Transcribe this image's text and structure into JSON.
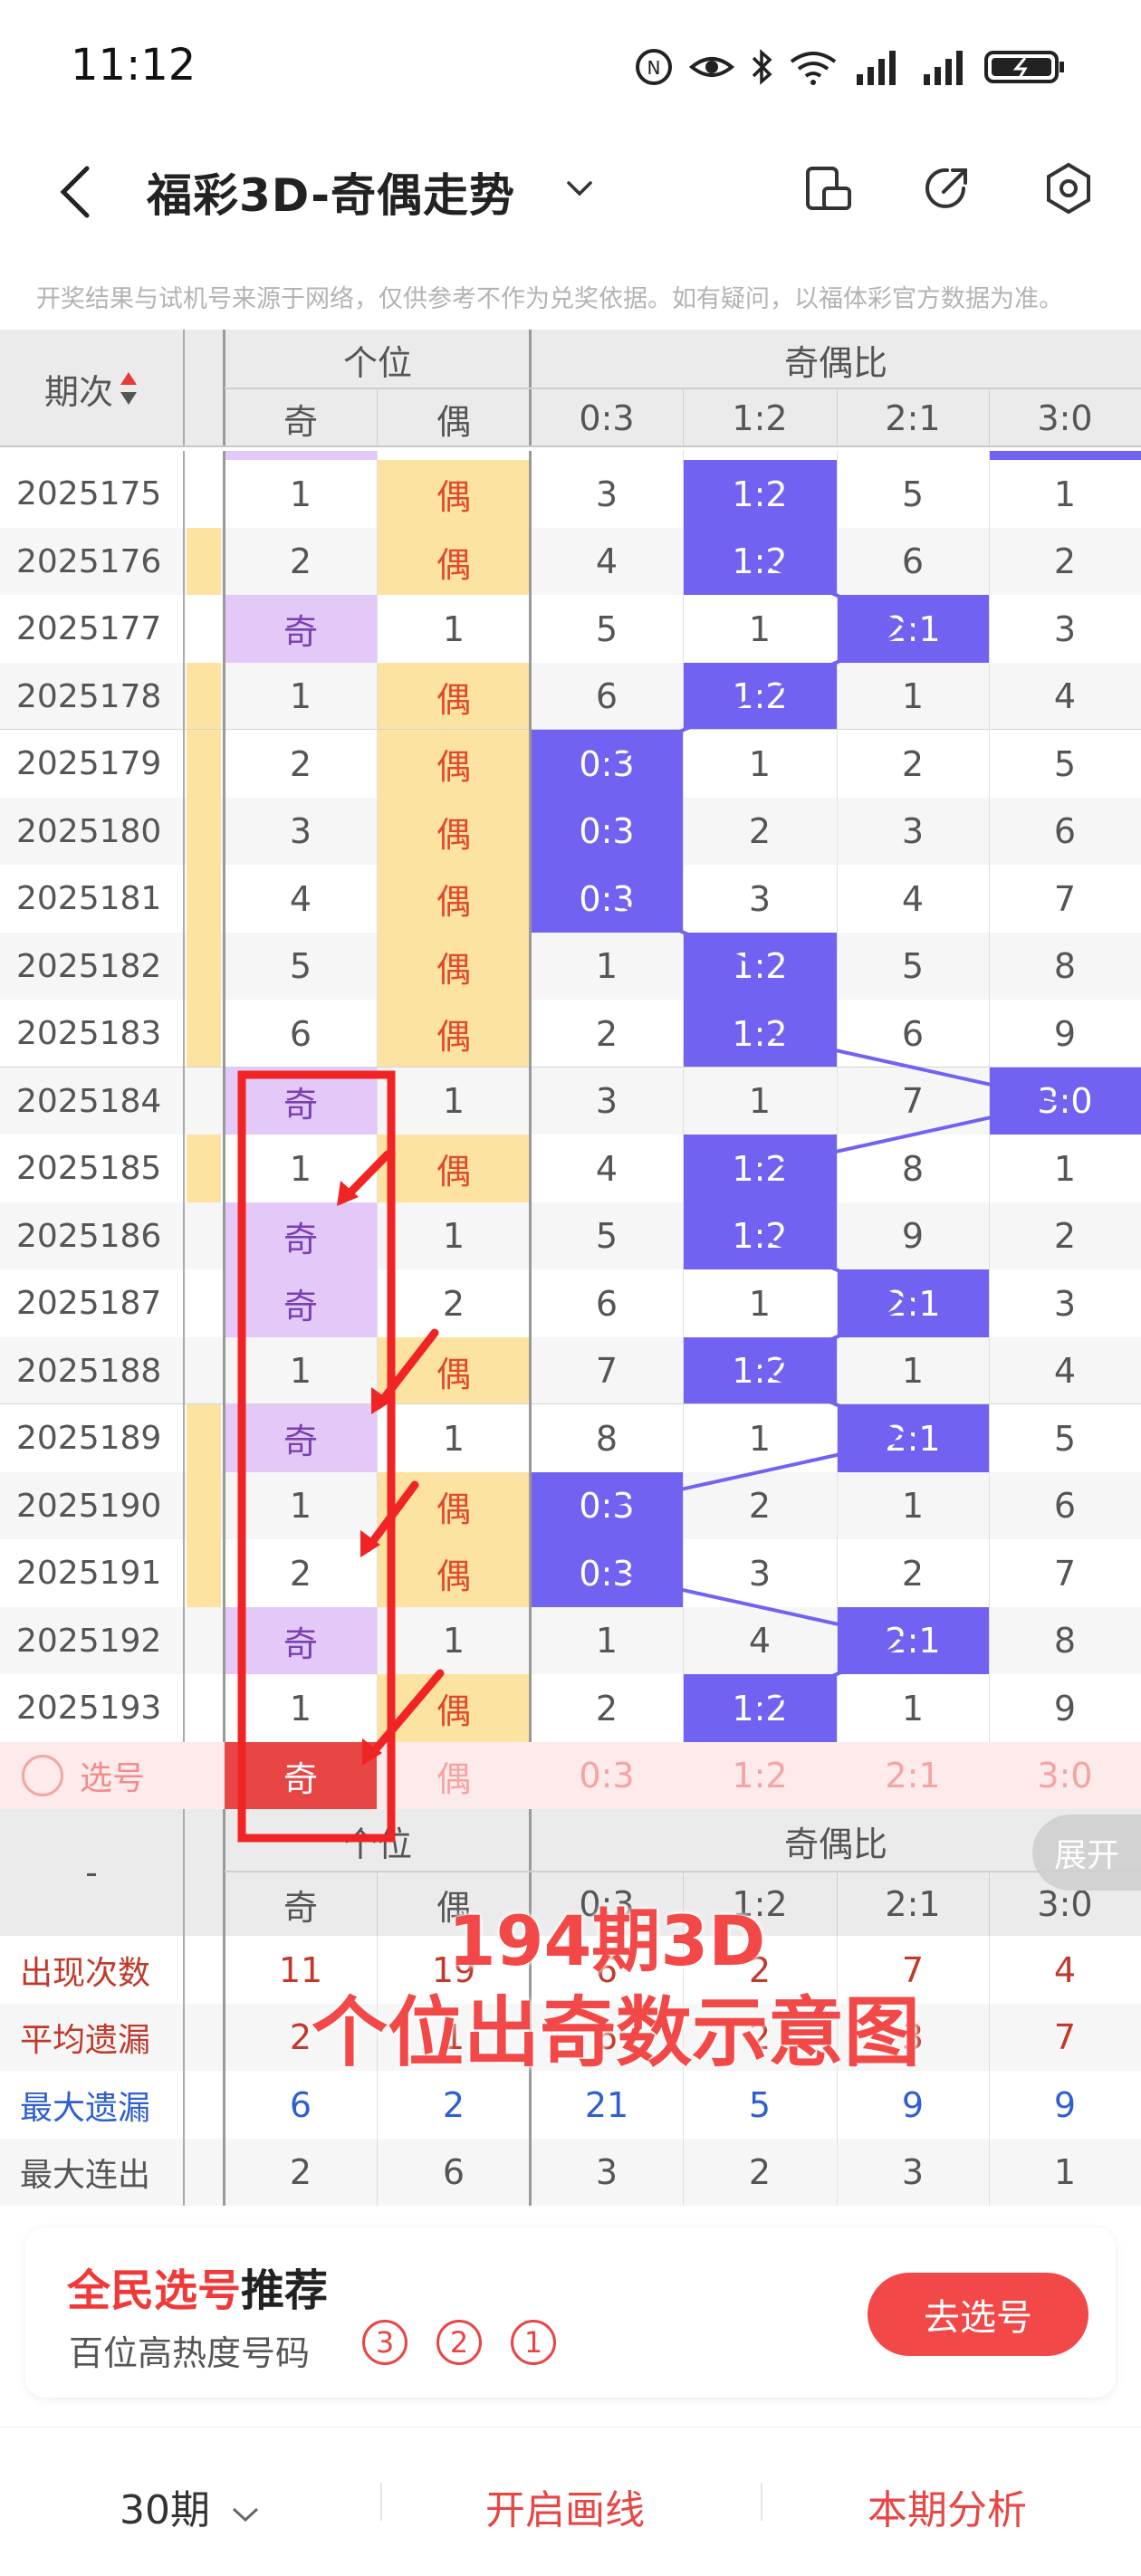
{
  "status_bar": {
    "time": "11:12"
  },
  "header": {
    "title": "福彩3D-奇偶走势",
    "notice": "开奖结果与试机号来源于网络，仅供参考不作为兑奖依据。如有疑问，以福体彩官方数据为准。"
  },
  "table": {
    "header": {
      "period": "期次",
      "group_ge": "个位",
      "group_ratio": "奇偶比",
      "sub": [
        "奇",
        "偶",
        "0:3",
        "1:2",
        "2:1",
        "3:0"
      ]
    },
    "rows": [
      {
        "period": "2025175",
        "side": false,
        "odd": "1",
        "even": "偶",
        "r": [
          "3",
          "1:2",
          "5",
          "1"
        ],
        "hit_odd": false,
        "ratio_hit": 1
      },
      {
        "period": "2025176",
        "side": true,
        "odd": "2",
        "even": "偶",
        "r": [
          "4",
          "1:2",
          "6",
          "2"
        ],
        "hit_odd": false,
        "ratio_hit": 1
      },
      {
        "period": "2025177",
        "side": false,
        "odd": "奇",
        "even": "1",
        "r": [
          "5",
          "1",
          "2:1",
          "3"
        ],
        "hit_odd": true,
        "ratio_hit": 2
      },
      {
        "period": "2025178",
        "side": true,
        "odd": "1",
        "even": "偶",
        "r": [
          "6",
          "1:2",
          "1",
          "4"
        ],
        "hit_odd": false,
        "ratio_hit": 1
      },
      {
        "period": "2025179",
        "side": true,
        "odd": "2",
        "even": "偶",
        "r": [
          "0:3",
          "1",
          "2",
          "5"
        ],
        "hit_odd": false,
        "ratio_hit": 0
      },
      {
        "period": "2025180",
        "side": true,
        "odd": "3",
        "even": "偶",
        "r": [
          "0:3",
          "2",
          "3",
          "6"
        ],
        "hit_odd": false,
        "ratio_hit": 0
      },
      {
        "period": "2025181",
        "side": true,
        "odd": "4",
        "even": "偶",
        "r": [
          "0:3",
          "3",
          "4",
          "7"
        ],
        "hit_odd": false,
        "ratio_hit": 0
      },
      {
        "period": "2025182",
        "side": true,
        "odd": "5",
        "even": "偶",
        "r": [
          "1",
          "1:2",
          "5",
          "8"
        ],
        "hit_odd": false,
        "ratio_hit": 1
      },
      {
        "period": "2025183",
        "side": true,
        "odd": "6",
        "even": "偶",
        "r": [
          "2",
          "1:2",
          "6",
          "9"
        ],
        "hit_odd": false,
        "ratio_hit": 1
      },
      {
        "period": "2025184",
        "side": false,
        "odd": "奇",
        "even": "1",
        "r": [
          "3",
          "1",
          "7",
          "3:0"
        ],
        "hit_odd": true,
        "ratio_hit": 3
      },
      {
        "period": "2025185",
        "side": true,
        "odd": "1",
        "even": "偶",
        "r": [
          "4",
          "1:2",
          "8",
          "1"
        ],
        "hit_odd": false,
        "ratio_hit": 1
      },
      {
        "period": "2025186",
        "side": false,
        "odd": "奇",
        "even": "1",
        "r": [
          "5",
          "1:2",
          "9",
          "2"
        ],
        "hit_odd": true,
        "ratio_hit": 1
      },
      {
        "period": "2025187",
        "side": false,
        "odd": "奇",
        "even": "2",
        "r": [
          "6",
          "1",
          "2:1",
          "3"
        ],
        "hit_odd": true,
        "ratio_hit": 2
      },
      {
        "period": "2025188",
        "side": false,
        "odd": "1",
        "even": "偶",
        "r": [
          "7",
          "1:2",
          "1",
          "4"
        ],
        "hit_odd": false,
        "ratio_hit": 1
      },
      {
        "period": "2025189",
        "side": true,
        "odd": "奇",
        "even": "1",
        "r": [
          "8",
          "1",
          "2:1",
          "5"
        ],
        "hit_odd": true,
        "ratio_hit": 2
      },
      {
        "period": "2025190",
        "side": true,
        "odd": "1",
        "even": "偶",
        "r": [
          "0:3",
          "2",
          "1",
          "6"
        ],
        "hit_odd": false,
        "ratio_hit": 0
      },
      {
        "period": "2025191",
        "side": true,
        "odd": "2",
        "even": "偶",
        "r": [
          "0:3",
          "3",
          "2",
          "7"
        ],
        "hit_odd": false,
        "ratio_hit": 0
      },
      {
        "period": "2025192",
        "side": false,
        "odd": "奇",
        "even": "1",
        "r": [
          "1",
          "4",
          "2:1",
          "8"
        ],
        "hit_odd": true,
        "ratio_hit": 2
      },
      {
        "period": "2025193",
        "side": false,
        "odd": "1",
        "even": "偶",
        "r": [
          "2",
          "1:2",
          "1",
          "9"
        ],
        "hit_odd": false,
        "ratio_hit": 1
      }
    ],
    "select_row": {
      "label": "选号",
      "cells": [
        "奇",
        "偶",
        "0:3",
        "1:2",
        "2:1",
        "3:0"
      ]
    },
    "footer_header": {
      "dash": "-",
      "group_ge": "个位",
      "group_ratio": "奇偶比",
      "expand": "展开",
      "sub": [
        "奇",
        "偶",
        "0:3",
        "1:2",
        "2:1",
        "3:0"
      ]
    },
    "stats": [
      {
        "label": "出现次数",
        "values": [
          "11",
          "19",
          "6",
          "2",
          "7",
          "4"
        ],
        "color": "#c0392b"
      },
      {
        "label": "平均遗漏",
        "values": [
          "2",
          "1",
          "6",
          "2",
          "3",
          "7"
        ],
        "color": "#c0392b"
      },
      {
        "label": "最大遗漏",
        "values": [
          "6",
          "2",
          "21",
          "5",
          "9",
          "9"
        ],
        "color": "#2f5fd0"
      },
      {
        "label": "最大连出",
        "values": [
          "2",
          "6",
          "3",
          "2",
          "3",
          "1"
        ],
        "color": "#555555"
      }
    ]
  },
  "overlay": {
    "line1": "194期3D",
    "line2": "个位出奇数示意图"
  },
  "recommend": {
    "title_red": "全民选号",
    "title_black": "推荐",
    "subtitle": "百位高热度号码",
    "balls": [
      "3",
      "2",
      "1"
    ],
    "button": "去选号"
  },
  "bottom_bar": {
    "periods": "30期",
    "draw": "开启画线",
    "analysis": "本期分析"
  },
  "colors": {
    "accent_red": "#f24848",
    "blue": "#7262f2",
    "odd_bg": "#e2c9f7",
    "even_bg": "#fde3a2"
  }
}
